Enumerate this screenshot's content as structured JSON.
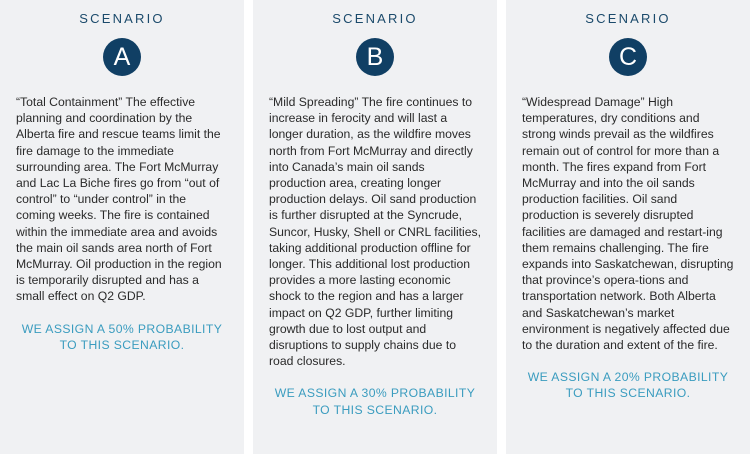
{
  "scenarios": [
    {
      "label": "SCENARIO",
      "letter": "A",
      "text": "“Total Containment” The effective planning and coordination by the Alberta fire and rescue teams limit the fire damage to the immediate surrounding area. The Fort McMurray and Lac La Biche fires go from “out of control” to “under control” in the coming weeks. The fire is contained within the immediate area and avoids the main oil sands area north of Fort McMurray.  Oil production in the region is temporarily disrupted and has a small effect on Q2 GDP.",
      "probability": "WE ASSIGN A 50% PROBABILITY TO THIS SCENARIO."
    },
    {
      "label": "SCENARIO",
      "letter": "B",
      "text": "“Mild Spreading” The fire continues to increase in ferocity and will last a longer duration, as the wildfire moves north from Fort McMurray and directly into Canada’s main oil sands production area, creating longer production delays. Oil sand production is further disrupted at the Syncrude, Suncor, Husky, Shell or CNRL facilities, taking additional production offline for longer. This additional lost production provides a more lasting economic shock to the region and has a larger impact on Q2 GDP, further limiting growth due to lost output and disruptions to supply chains due to road closures.",
      "probability": "WE ASSIGN A 30% PROBABILITY TO THIS SCENARIO."
    },
    {
      "label": "SCENARIO",
      "letter": "C",
      "text": "“Widespread Damage” High temperatures, dry conditions and strong winds prevail as the wildfires remain out of control for more than a month. The fires expand from Fort McMurray and into the oil sands production facilities. Oil sand production is severely disrupted facilities are damaged and restart-ing them remains challenging. The fire expands into Saskatchewan, disrupting that province’s opera-tions and transportation network. Both Alberta and Saskatchewan’s market environment is negatively affected due to the duration and extent of the fire.",
      "probability": "WE ASSIGN A 20% PROBABILITY TO THIS SCENARIO."
    }
  ],
  "colors": {
    "card_bg": "#f0f1f3",
    "badge": "#103f64",
    "label": "#1b4a6b",
    "probability": "#3a9cbf",
    "text": "#2a2a2a"
  }
}
